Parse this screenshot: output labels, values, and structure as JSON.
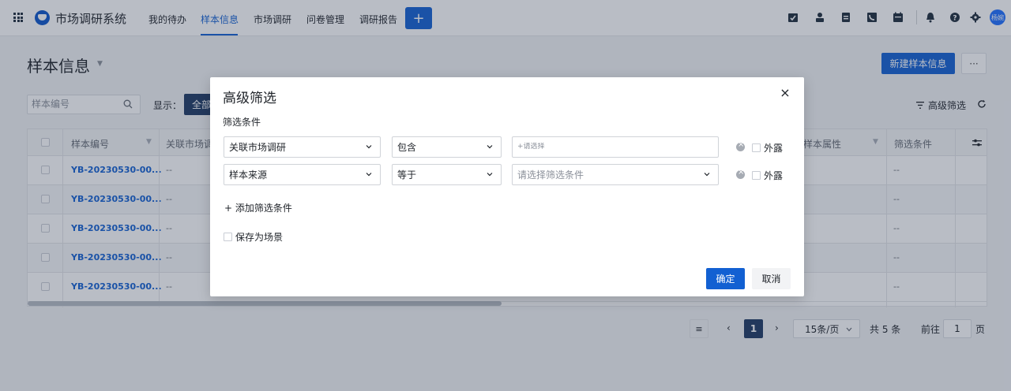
{
  "app": {
    "title": "市场调研系统"
  },
  "nav": {
    "items": [
      {
        "label": "我的待办"
      },
      {
        "label": "样本信息"
      },
      {
        "label": "市场调研"
      },
      {
        "label": "问卷管理"
      },
      {
        "label": "调研报告"
      }
    ],
    "add_label": "+",
    "user_initials": "杨婉"
  },
  "page": {
    "title": "样本信息",
    "new_button": "新建样本信息",
    "more_button": "···",
    "search_placeholder": "样本编号",
    "show_label": "显示：",
    "show_chip": "全部",
    "advanced_filter": "高级筛选"
  },
  "table": {
    "columns": [
      "样本编号",
      "关联市场调研",
      "样本属性",
      "筛选条件"
    ],
    "rows": [
      {
        "id": "YB-20230530-00...",
        "related": "--",
        "filter": "--"
      },
      {
        "id": "YB-20230530-00...",
        "related": "--",
        "filter": "--"
      },
      {
        "id": "YB-20230530-00...",
        "related": "--",
        "filter": "--"
      },
      {
        "id": "YB-20230530-00...",
        "related": "--",
        "filter": "--"
      },
      {
        "id": "YB-20230530-00...",
        "related": "--",
        "filter": "--"
      }
    ]
  },
  "pagination": {
    "prev": "‹",
    "next": "›",
    "current_page": "1",
    "page_size": "15条/页",
    "total": "共 5 条",
    "goto_label": "前往",
    "goto_value": "1",
    "page_unit": "页"
  },
  "modal": {
    "title": "高级筛选",
    "close": "×",
    "section_label": "筛选条件",
    "conditions": [
      {
        "field": "关联市场调研",
        "operator": "包含",
        "value_placeholder": "+请选择",
        "expose_label": "外露"
      },
      {
        "field": "样本来源",
        "operator": "等于",
        "value_placeholder": "请选择筛选条件",
        "expose_label": "外露"
      }
    ],
    "add_condition": "+ 添加筛选条件",
    "save_scene": "保存为场景",
    "confirm": "确定",
    "cancel": "取消"
  }
}
